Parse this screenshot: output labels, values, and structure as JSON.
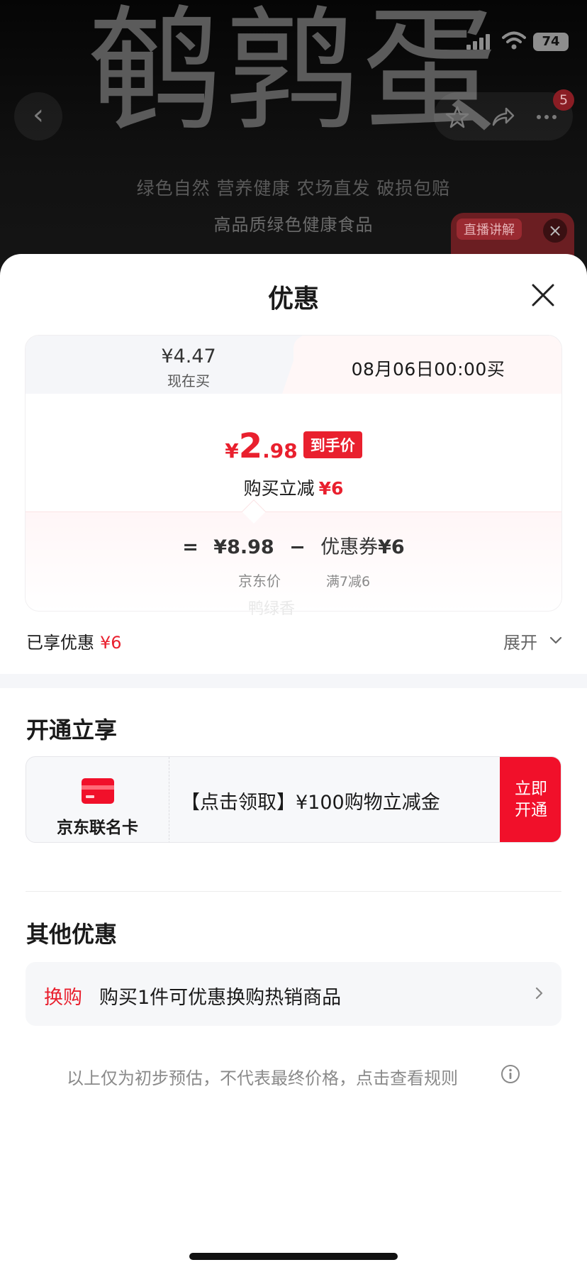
{
  "hero": {
    "title": "鹌鹑蛋",
    "subtitle": "绿色自然 营养健康  农场直发 破损包赔",
    "subtitle2": "高品质绿色健康食品",
    "battery": "74",
    "cart_badge": "5",
    "live_tag": "直播讲解"
  },
  "sheet": {
    "title": "优惠",
    "now_tab": {
      "price": "¥4.47",
      "label": "现在买"
    },
    "later_tab": {
      "label": "08月06日00:00买"
    },
    "final": {
      "yen": "¥",
      "int": "2",
      "dec": ".98",
      "tag": "到手价"
    },
    "cut": {
      "label": "购买立减",
      "amount": "¥6"
    },
    "formula": {
      "eq": "=",
      "jd_price": "¥8.98",
      "minus": "−",
      "coupon_label": "优惠券",
      "coupon_amount": "¥6",
      "jd_label": "京东价",
      "coupon_rule": "满7减6"
    },
    "watermark": "鸭绿香",
    "enjoyed": {
      "label": "已享优惠",
      "amount": "¥6"
    },
    "expand_label": "展开",
    "open_section": {
      "title": "开通立享",
      "card_name": "京东联名卡",
      "card_text": "【点击领取】¥100购物立减金",
      "button_line1": "立即",
      "button_line2": "开通"
    },
    "other_section": {
      "title": "其他优惠",
      "tag": "换购",
      "text": "购买1件可优惠换购热销商品"
    },
    "footnote": "以上仅为初步预估，不代表最终价格，点击查看规则"
  },
  "colors": {
    "accent_red": "#e9202e",
    "button_red": "#f1102a",
    "soft_gray_bg": "#f5f6f9"
  }
}
